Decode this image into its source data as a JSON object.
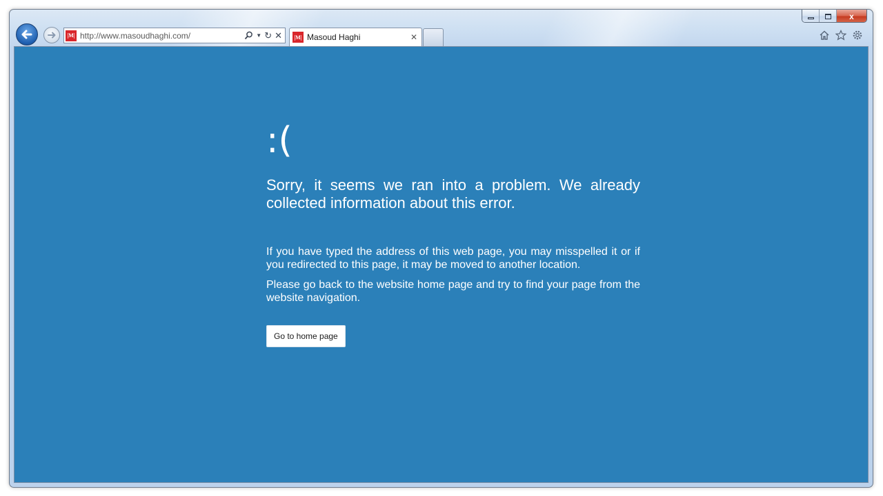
{
  "browser": {
    "address_url": "http://www.masoudhaghi.com/",
    "favicon_text": "|M|",
    "tab_title": "Masoud Haghi",
    "caption": {
      "minimize": "▭",
      "maximize": "□",
      "close": "x"
    }
  },
  "page": {
    "sad_face": ":(",
    "headline": "Sorry, it seems we ran into a problem. We already collected information about this error.",
    "paragraph1": "If you have typed the address of this web page, you may misspelled it or if you redirected to this page, it may be moved to another location.",
    "paragraph2": "Please go back to the website home page and try to find your page from the website navigation.",
    "home_button_label": "Go to home page",
    "background_color": "#2b80b9"
  }
}
